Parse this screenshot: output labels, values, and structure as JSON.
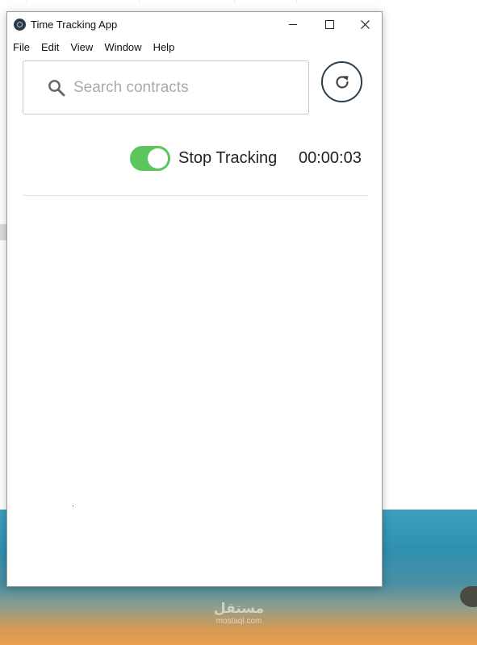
{
  "window": {
    "title": "Time Tracking App",
    "controls": {
      "minimize": "minimize",
      "maximize": "maximize",
      "close": "close"
    }
  },
  "menu": {
    "items": [
      "File",
      "Edit",
      "View",
      "Window",
      "Help"
    ]
  },
  "search": {
    "placeholder": "Search contracts",
    "value": ""
  },
  "tracking": {
    "toggle_on": true,
    "label": "Stop Tracking",
    "elapsed": "00:00:03"
  },
  "icons": {
    "app": "app-logo-icon",
    "search": "search-icon",
    "refresh": "refresh-icon"
  },
  "colors": {
    "toggle_active": "#5cc65c",
    "refresh_border": "#2c3e4a",
    "placeholder": "#a9a9a9"
  },
  "watermark": {
    "main": "مستقل",
    "sub": "mostaql.com"
  }
}
